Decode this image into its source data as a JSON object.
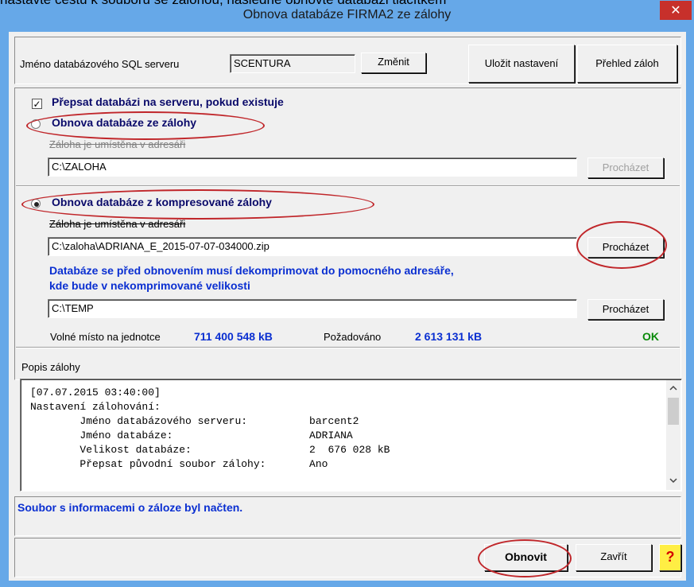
{
  "background_text": "nastavte cestu k souboru se zálohou, následně obnovte databázi tlačítkem",
  "window": {
    "title": "Obnova databáze FIRMA2 ze zálohy",
    "close_glyph": "✕"
  },
  "server": {
    "label": "Jméno databázového SQL serveru",
    "value": "SCENTURA",
    "change_button": "Změnit"
  },
  "toolbar": {
    "save_settings": "Uložit nastavení",
    "backup_overview": "Přehled záloh"
  },
  "overwrite": {
    "label": "Přepsat databázi na serveru, pokud existuje",
    "checked": true
  },
  "restore_plain": {
    "radio_label": "Obnova databáze ze zálohy",
    "selected": false,
    "path_label": "Záloha je umístěna v adresáři",
    "path_value": "C:\\ZALOHA",
    "browse_button": "Procházet"
  },
  "restore_compressed": {
    "radio_label": "Obnova databáze z kompresované zálohy",
    "selected": true,
    "path_label": "Záloha je umístěna v adresáři",
    "path_value": "C:\\zaloha\\ADRIANA_E_2015-07-07-034000.zip",
    "browse_button": "Procházet",
    "note_line1": "Databáze se před obnovením musí dekomprimovat do pomocného adresáře,",
    "note_line2": "kde bude v nekomprimované velikosti",
    "temp_value": "C:\\TEMP",
    "temp_browse_button": "Procházet",
    "free_space_label": "Volné místo na jednotce",
    "free_space_value": "711 400 548 kB",
    "required_label": "Požadováno",
    "required_value": "2 613 131 kB",
    "status": "OK"
  },
  "description": {
    "label": "Popis zálohy",
    "lines": [
      "[07.07.2015 03:40:00]",
      "Nastavení zálohování:",
      "        Jméno databázového serveru:          barcent2",
      "        Jméno databáze:                      ADRIANA",
      "        Velikost databáze:                   2  676 028 kB",
      "        Přepsat původní soubor zálohy:       Ano"
    ]
  },
  "status_message": "Soubor s informacemi o záloze byl načten.",
  "footer": {
    "restore_button": "Obnovit",
    "close_button": "Zavřít",
    "help_glyph": "?"
  },
  "colors": {
    "title_bar": "#66a8e8",
    "close": "#c7302b",
    "accent_blue": "#0a2fd1",
    "annotation": "#c0262a",
    "ok_green": "#0a8a0a"
  },
  "icons": {
    "close": "close-icon",
    "help": "question-mark-icon",
    "scroll_up": "chevron-up-icon",
    "scroll_down": "chevron-down-icon"
  }
}
